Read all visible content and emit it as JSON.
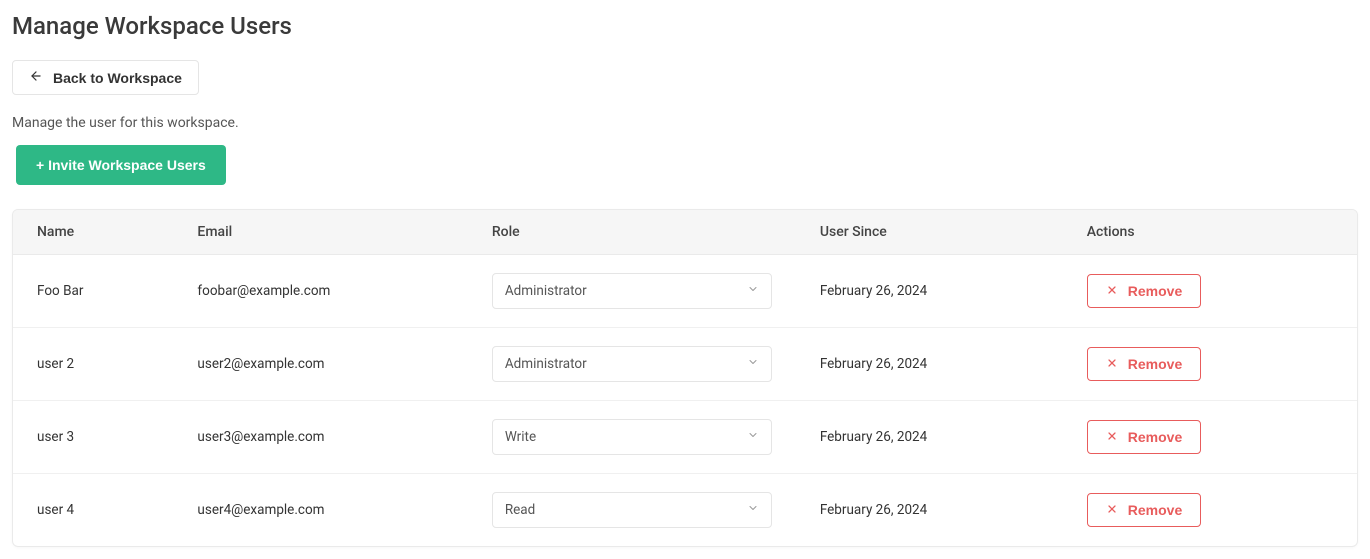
{
  "page": {
    "title": "Manage Workspace Users",
    "back_label": "Back to Workspace",
    "subtitle": "Manage the user for this workspace.",
    "invite_label": "+ Invite Workspace Users"
  },
  "table": {
    "headers": {
      "name": "Name",
      "email": "Email",
      "role": "Role",
      "since": "User Since",
      "actions": "Actions"
    },
    "remove_label": "Remove",
    "rows": [
      {
        "name": "Foo Bar",
        "email": "foobar@example.com",
        "role": "Administrator",
        "since": "February 26, 2024"
      },
      {
        "name": "user 2",
        "email": "user2@example.com",
        "role": "Administrator",
        "since": "February 26, 2024"
      },
      {
        "name": "user 3",
        "email": "user3@example.com",
        "role": "Write",
        "since": "February 26, 2024"
      },
      {
        "name": "user 4",
        "email": "user4@example.com",
        "role": "Read",
        "since": "February 26, 2024"
      }
    ]
  }
}
